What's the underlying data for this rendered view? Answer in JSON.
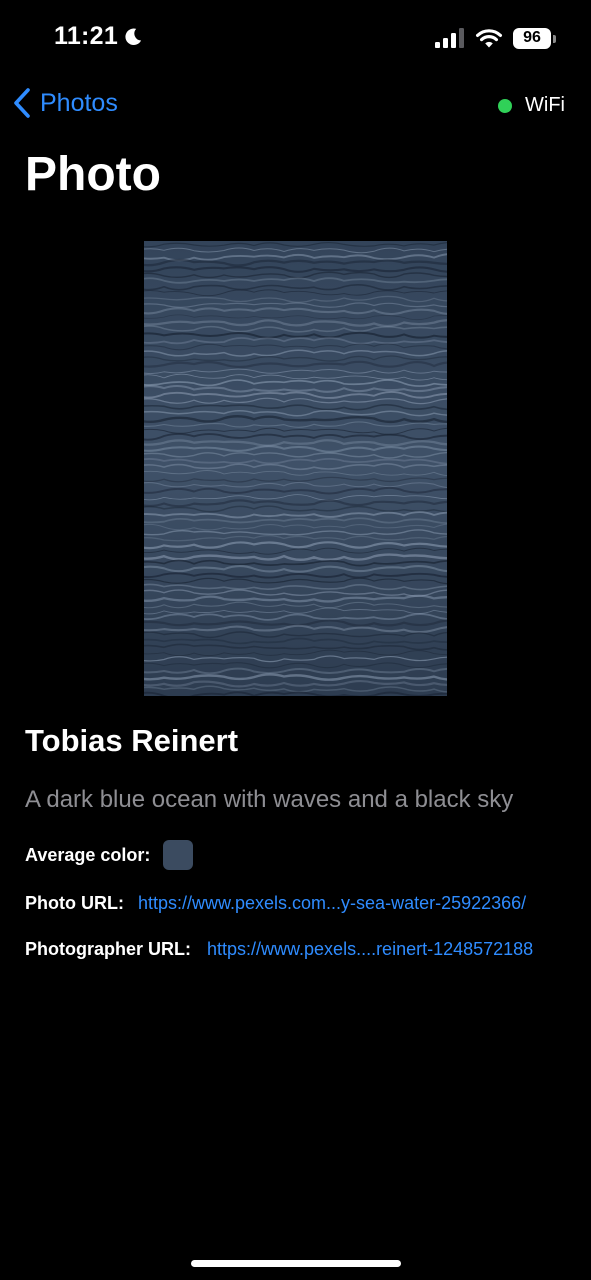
{
  "status_bar": {
    "time": "11:21",
    "focus_icon": "moon-icon",
    "battery_level": "96",
    "signal_icon": "cellular-signal-icon",
    "wifi_icon": "wifi-icon"
  },
  "nav": {
    "back_label": "Photos",
    "back_icon": "chevron-left-icon",
    "connection_label": "WiFi",
    "connection_color": "#30d158"
  },
  "page": {
    "title": "Photo"
  },
  "photo": {
    "photographer": "Tobias Reinert",
    "description": "A dark blue ocean with waves and a black sky",
    "average_color_label": "Average color:",
    "average_color": "#3b4b60",
    "photo_url_label": "Photo URL:",
    "photo_url": "https://www.pexels.com...y-sea-water-25922366/",
    "photographer_url_label": "Photographer URL:",
    "photographer_url": "https://www.pexels....reinert-1248572188"
  },
  "colors": {
    "accent": "#2f8cff",
    "background": "#000000",
    "secondary_text": "#8e8e93"
  }
}
